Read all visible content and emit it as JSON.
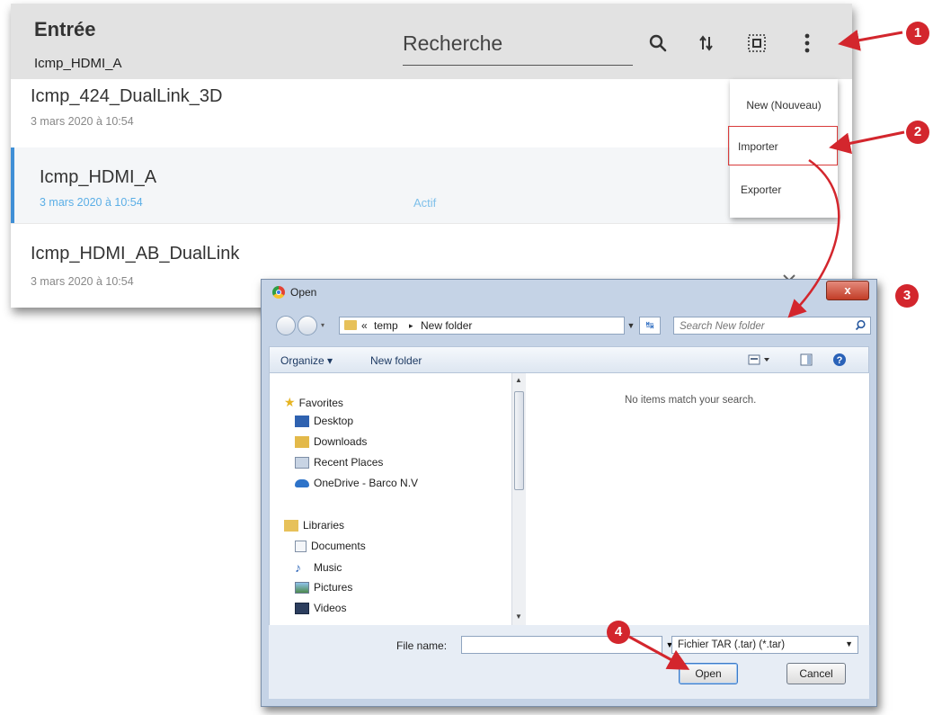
{
  "app": {
    "title": "Entrée",
    "subtitle": "Icmp_HDMI_A",
    "search_placeholder": "Recherche",
    "rows": [
      {
        "name": "Icmp_424_DualLink_3D",
        "date": "3 mars 2020 à 10:54",
        "status": ""
      },
      {
        "name": "Icmp_HDMI_A",
        "date": "3 mars 2020 à 10:54",
        "status": "Actif"
      },
      {
        "name": "Icmp_HDMI_AB_DualLink",
        "date": "3 mars 2020 à 10:54",
        "status": ""
      }
    ],
    "selected_row": 1,
    "menu": {
      "items": [
        "New (Nouveau)",
        "Importer",
        "Exporter"
      ],
      "highlighted": 1
    }
  },
  "dialog": {
    "title": "Open",
    "close_label": "x",
    "address": {
      "chevrons": "«",
      "segments": [
        "temp",
        "New folder"
      ],
      "separator": "▸"
    },
    "search_placeholder": "Search New folder",
    "toolbar": {
      "organize": "Organize ▾",
      "new_folder": "New folder"
    },
    "nav": {
      "favorites_label": "Favorites",
      "favorites": [
        "Desktop",
        "Downloads",
        "Recent Places",
        "OneDrive - Barco N.V"
      ],
      "libraries_label": "Libraries",
      "libraries": [
        "Documents",
        "Music",
        "Pictures",
        "Videos"
      ]
    },
    "empty_message": "No items match your search.",
    "file_name_label": "File name:",
    "file_name_value": "",
    "file_type": "Fichier TAR (.tar) (*.tar)",
    "open_label": "Open",
    "cancel_label": "Cancel"
  },
  "callouts": [
    "1",
    "2",
    "3",
    "4"
  ],
  "colors": {
    "accent": "#3f8fd6",
    "callout": "#d3262d",
    "header_bg": "#e2e2e2"
  }
}
